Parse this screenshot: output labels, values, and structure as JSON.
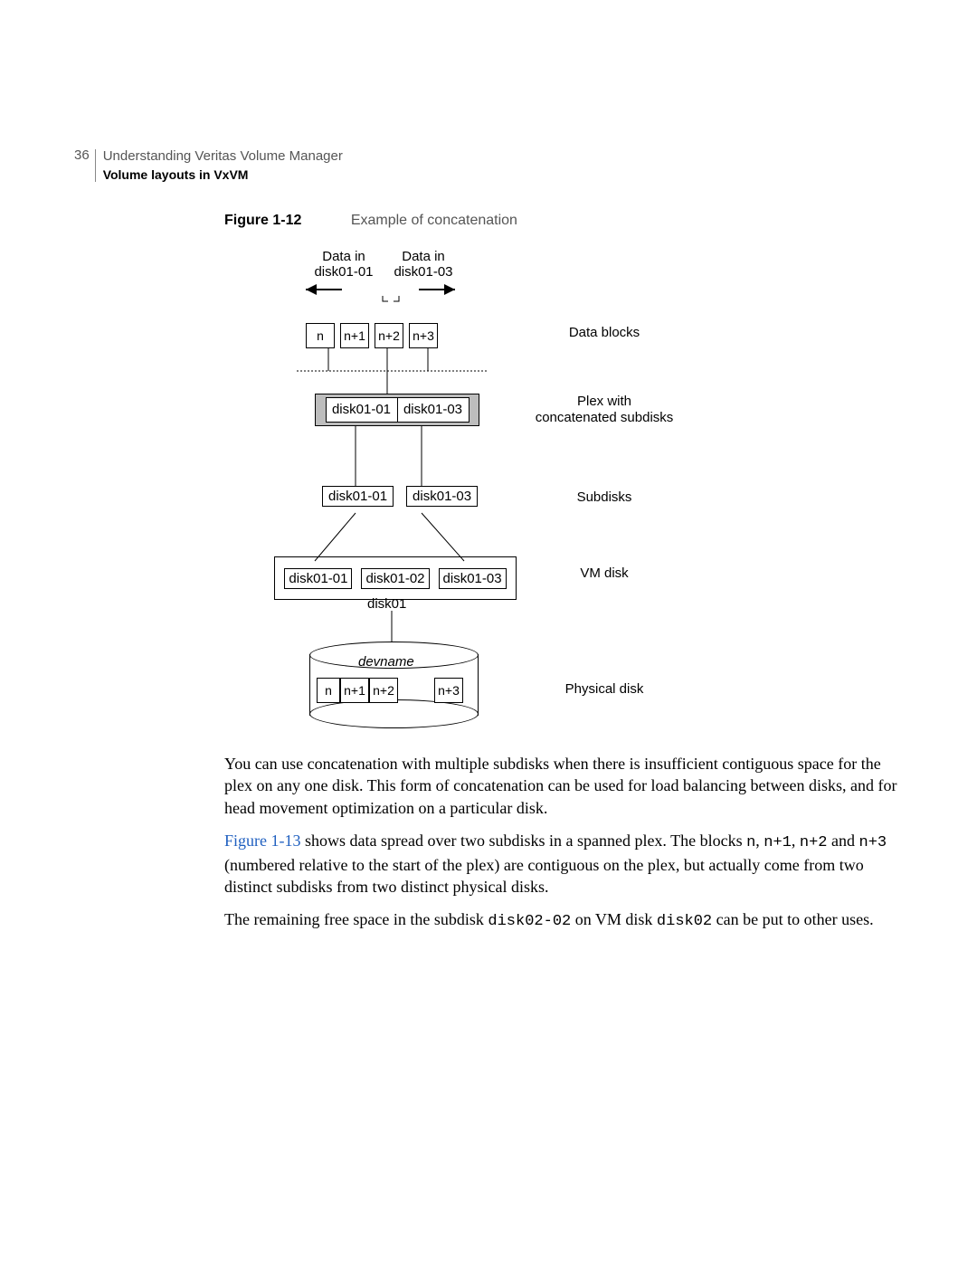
{
  "header": {
    "page_number": "36",
    "chapter": "Understanding Veritas Volume Manager",
    "section": "Volume layouts in VxVM"
  },
  "figure": {
    "label": "Figure 1-12",
    "caption": "Example of concatenation"
  },
  "diagram": {
    "top_labels": {
      "left": "Data in\ndisk01-01",
      "right": "Data in\ndisk01-03"
    },
    "blocks": [
      "n",
      "n+1",
      "n+2",
      "n+3"
    ],
    "right_labels": {
      "data_blocks": "Data blocks",
      "plex": "Plex with\nconcatenated subdisks",
      "subdisks": "Subdisks",
      "vmdisk": "VM disk",
      "physical": "Physical disk"
    },
    "plex_cells": [
      "disk01-01",
      "disk01-03"
    ],
    "subdisks": [
      "disk01-01",
      "disk01-03"
    ],
    "vm_cells": [
      "disk01-01",
      "disk01-02",
      "disk01-03"
    ],
    "vm_name": "disk01",
    "devname": "devname",
    "phys_blocks": [
      "n",
      "n+1",
      "n+2",
      "n+3"
    ]
  },
  "paragraphs": {
    "p1": "You can use concatenation with multiple subdisks when there is insufficient contiguous space for the plex on any one disk. This form of concatenation can be used for load balancing between disks, and for head movement optimization on a particular disk.",
    "p2a": "Figure 1-13",
    "p2b": " shows data spread over two subdisks in a spanned plex. The blocks ",
    "p2c": "n",
    "p2d": ", ",
    "p2e": "n+1",
    "p2f": ", ",
    "p2g": "n+2",
    "p2h": " and ",
    "p2i": "n+3",
    "p2j": " (numbered relative to the start of the plex) are contiguous on the plex, but actually come from two distinct subdisks from two distinct physical disks.",
    "p3a": "The remaining free space in the subdisk ",
    "p3b": "disk02-02",
    "p3c": " on VM disk ",
    "p3d": "disk02",
    "p3e": " can be put to other uses."
  }
}
